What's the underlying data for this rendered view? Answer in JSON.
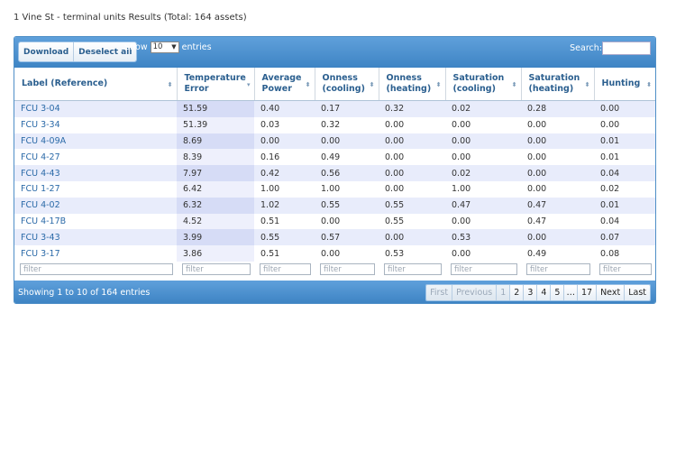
{
  "page": {
    "title": "1 Vine St - terminal units Results (Total: 164 assets)"
  },
  "toolbar": {
    "download_label": "Download",
    "deselect_label": "Deselect all",
    "show_label": "Show",
    "page_size": "10",
    "entries_label": "entries",
    "search_label": "Search:",
    "search_value": ""
  },
  "table": {
    "columns": [
      "Label (Reference)",
      "Temperature Error",
      "Average Power",
      "Onness (cooling)",
      "Onness (heating)",
      "Saturation (cooling)",
      "Saturation (heating)",
      "Hunting"
    ],
    "rows": [
      [
        "FCU 3-04",
        "51.59",
        "0.40",
        "0.17",
        "0.32",
        "0.02",
        "0.28",
        "0.00"
      ],
      [
        "FCU 3-34",
        "51.39",
        "0.03",
        "0.32",
        "0.00",
        "0.00",
        "0.00",
        "0.00"
      ],
      [
        "FCU 4-09A",
        "8.69",
        "0.00",
        "0.00",
        "0.00",
        "0.00",
        "0.00",
        "0.01"
      ],
      [
        "FCU 4-27",
        "8.39",
        "0.16",
        "0.49",
        "0.00",
        "0.00",
        "0.00",
        "0.01"
      ],
      [
        "FCU 4-43",
        "7.97",
        "0.42",
        "0.56",
        "0.00",
        "0.02",
        "0.00",
        "0.04"
      ],
      [
        "FCU 1-27",
        "6.42",
        "1.00",
        "1.00",
        "0.00",
        "1.00",
        "0.00",
        "0.02"
      ],
      [
        "FCU 4-02",
        "6.32",
        "1.02",
        "0.55",
        "0.55",
        "0.47",
        "0.47",
        "0.01"
      ],
      [
        "FCU 4-17B",
        "4.52",
        "0.51",
        "0.00",
        "0.55",
        "0.00",
        "0.47",
        "0.04"
      ],
      [
        "FCU 3-43",
        "3.99",
        "0.55",
        "0.57",
        "0.00",
        "0.53",
        "0.00",
        "0.07"
      ],
      [
        "FCU 3-17",
        "3.86",
        "0.51",
        "0.00",
        "0.53",
        "0.00",
        "0.49",
        "0.08"
      ]
    ],
    "filter_placeholder": "filter"
  },
  "footer": {
    "info": "Showing 1 to 10 of 164 entries",
    "first": "First",
    "previous": "Previous",
    "pages": [
      "1",
      "2",
      "3",
      "4",
      "5"
    ],
    "ellipsis": "…",
    "last_page": "17",
    "next": "Next",
    "last": "Last"
  },
  "colors": {
    "accent": "#4a90d2",
    "link": "#2b6aa8",
    "row_stripe": "#e8ecfb",
    "sorted_column": "#d6dcf6"
  },
  "icons": {
    "sort": "sort-both-icon",
    "sort_desc": "sort-desc-icon",
    "select_arrow": "chevron-down-icon"
  }
}
